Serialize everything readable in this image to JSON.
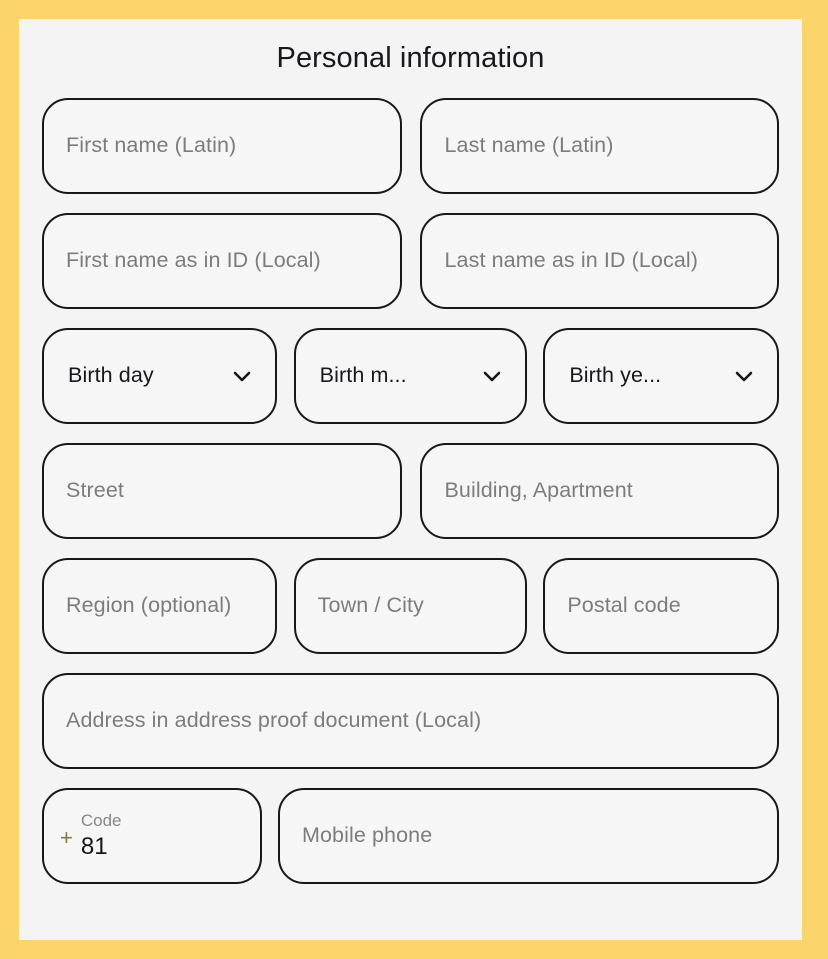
{
  "theme": {
    "frame_color": "#fbd46b",
    "panel_color": "#f4f4f4",
    "field_fill": "#f6f6f6",
    "field_border": "#18181a",
    "placeholder_color": "#7c7c7c",
    "text_color": "#17181b",
    "plus_color": "#7d7d3c"
  },
  "form": {
    "title": "Personal information",
    "rows": {
      "names_latin": {
        "first_name": {
          "placeholder": "First name (Latin)",
          "value": ""
        },
        "last_name": {
          "placeholder": "Last name (Latin)",
          "value": ""
        }
      },
      "names_local": {
        "first_name_id": {
          "placeholder": "First name as in ID (Local)",
          "value": ""
        },
        "last_name_id": {
          "placeholder": "Last name as in ID (Local)",
          "value": ""
        }
      },
      "birth": {
        "day": {
          "label": "Birth day",
          "icon": "chevron-down-icon"
        },
        "month": {
          "label": "Birth m...",
          "icon": "chevron-down-icon"
        },
        "year": {
          "label": "Birth ye...",
          "icon": "chevron-down-icon"
        }
      },
      "address_line": {
        "street": {
          "placeholder": "Street",
          "value": ""
        },
        "building": {
          "placeholder": "Building, Apartment",
          "value": ""
        }
      },
      "locality": {
        "region": {
          "placeholder": "Region (optional)",
          "value": ""
        },
        "town": {
          "placeholder": "Town / City",
          "value": ""
        },
        "postal": {
          "placeholder": "Postal code",
          "value": ""
        }
      },
      "address_proof": {
        "address_document": {
          "placeholder": "Address in address proof document (Local)",
          "value": ""
        }
      },
      "phone": {
        "code": {
          "prefix": "+",
          "label": "Code",
          "value": "81"
        },
        "mobile": {
          "placeholder": "Mobile phone",
          "value": ""
        }
      }
    }
  }
}
